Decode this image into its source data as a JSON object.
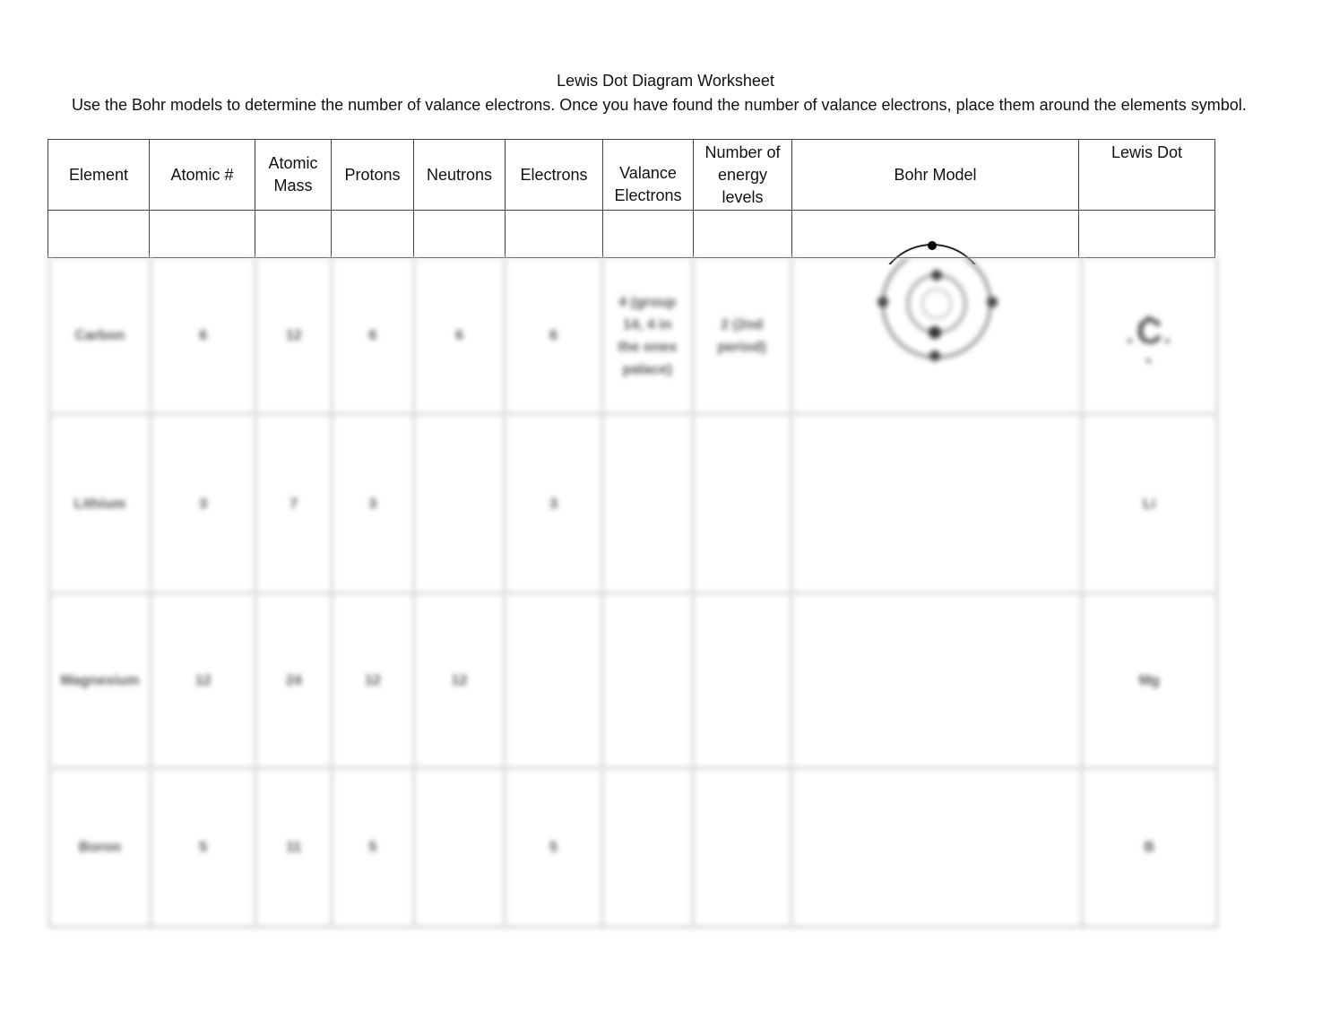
{
  "document": {
    "title": "Lewis Dot Diagram Worksheet",
    "instructions": "Use the Bohr models to determine the number of valance electrons.  Once you have found the number of valance electrons, place them around the elements symbol."
  },
  "table": {
    "headers": [
      "Element",
      "Atomic #",
      "Atomic Mass",
      "Protons",
      "Neutrons",
      "Electrons",
      "Valance Electrons",
      "Number of energy levels",
      "Bohr Model",
      "Lewis Dot"
    ],
    "rows": [
      {
        "element": "Carbon",
        "atomic_number": "6",
        "atomic_mass": "12",
        "protons": "6",
        "neutrons": "6",
        "electrons": "6",
        "valence": "4 (group 14, 4 in the ones palace)",
        "energy_levels": "2 (2nd period)",
        "bohr_model": "carbon-bohr-diagram",
        "lewis_dot": "C"
      },
      {
        "element": "Lithium",
        "atomic_number": "3",
        "atomic_mass": "7",
        "protons": "3",
        "neutrons": "",
        "electrons": "3",
        "valence": "",
        "energy_levels": "",
        "bohr_model": "",
        "lewis_dot": "Li"
      },
      {
        "element": "Magnesium",
        "atomic_number": "12",
        "atomic_mass": "24",
        "protons": "12",
        "neutrons": "12",
        "electrons": "",
        "valence": "",
        "energy_levels": "",
        "bohr_model": "",
        "lewis_dot": "Mg"
      },
      {
        "element": "Boron",
        "atomic_number": "5",
        "atomic_mass": "11",
        "protons": "5",
        "neutrons": "",
        "electrons": "5",
        "valence": "",
        "energy_levels": "",
        "bohr_model": "",
        "lewis_dot": "B"
      }
    ]
  }
}
